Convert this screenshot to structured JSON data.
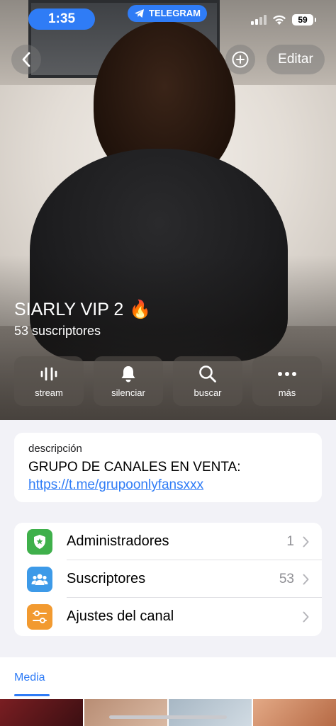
{
  "status_bar": {
    "time": "1:35",
    "telegram_label": "TELEGRAM",
    "battery": "59"
  },
  "nav": {
    "back_icon": "chevron-left-icon",
    "add_icon": "plus-circle-icon",
    "edit_label": "Editar"
  },
  "channel": {
    "title": "SIARLY VIP 2",
    "title_emoji": "🔥",
    "subscribers": "53 suscriptores"
  },
  "actions": [
    {
      "label": "stream",
      "icon": "stream-icon"
    },
    {
      "label": "silenciar",
      "icon": "bell-icon"
    },
    {
      "label": "buscar",
      "icon": "search-icon"
    },
    {
      "label": "más",
      "icon": "more-icon"
    }
  ],
  "description": {
    "label": "descripción",
    "text": "GRUPO DE CANALES EN VENTA:",
    "link": "https://t.me/grupoonlyfansxxx"
  },
  "menu": [
    {
      "label": "Administradores",
      "value": "1",
      "icon": "admin-shield-icon",
      "color": "#3fb04b"
    },
    {
      "label": "Suscriptores",
      "value": "53",
      "icon": "people-icon",
      "color": "#3d9ae8"
    },
    {
      "label": "Ajustes del canal",
      "value": "",
      "icon": "settings-sliders-icon",
      "color": "#f29a30"
    }
  ],
  "media": {
    "tab_label": "Media"
  },
  "colors": {
    "accent": "#2f7cf6",
    "background": "#f2f2f7"
  }
}
